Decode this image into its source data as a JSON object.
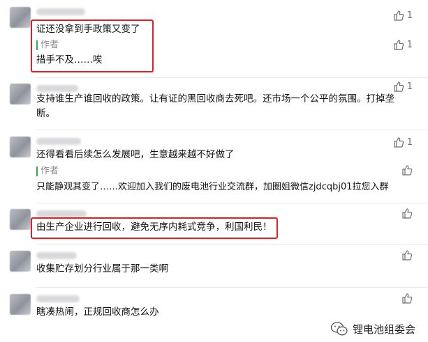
{
  "comments": [
    {
      "text": "证还没拿到手政策又变了",
      "likes": "1",
      "author_label": "作者",
      "reply": "措手不及……唉",
      "reply_likes": "1"
    },
    {
      "text": "支持谁生产谁回收的政策。让有证的黑回收商去死吧。还市场一个公平的氛围。打掉垄断。",
      "likes": "1"
    },
    {
      "text": "还得看看后续怎么发展吧，生意越来越不好做了",
      "likes": "1",
      "author_label": "作者",
      "reply": "只能静观其变了……欢迎加入我们的废电池行业交流群，加圈姐微信zjdcqbj01拉您入群"
    },
    {
      "text": "由生产企业进行回收，避免无序内耗式竞争，利国利民！"
    },
    {
      "text": "收集贮存划分行业属于那一类啊"
    },
    {
      "text": "瞎凑热闹，正规回收商怎么办"
    }
  ],
  "watermark": {
    "text": "锂电池组委会",
    "icon": "wechat-icon"
  },
  "colors": {
    "highlight": "#e02020",
    "author_bar": "#28b34a"
  }
}
